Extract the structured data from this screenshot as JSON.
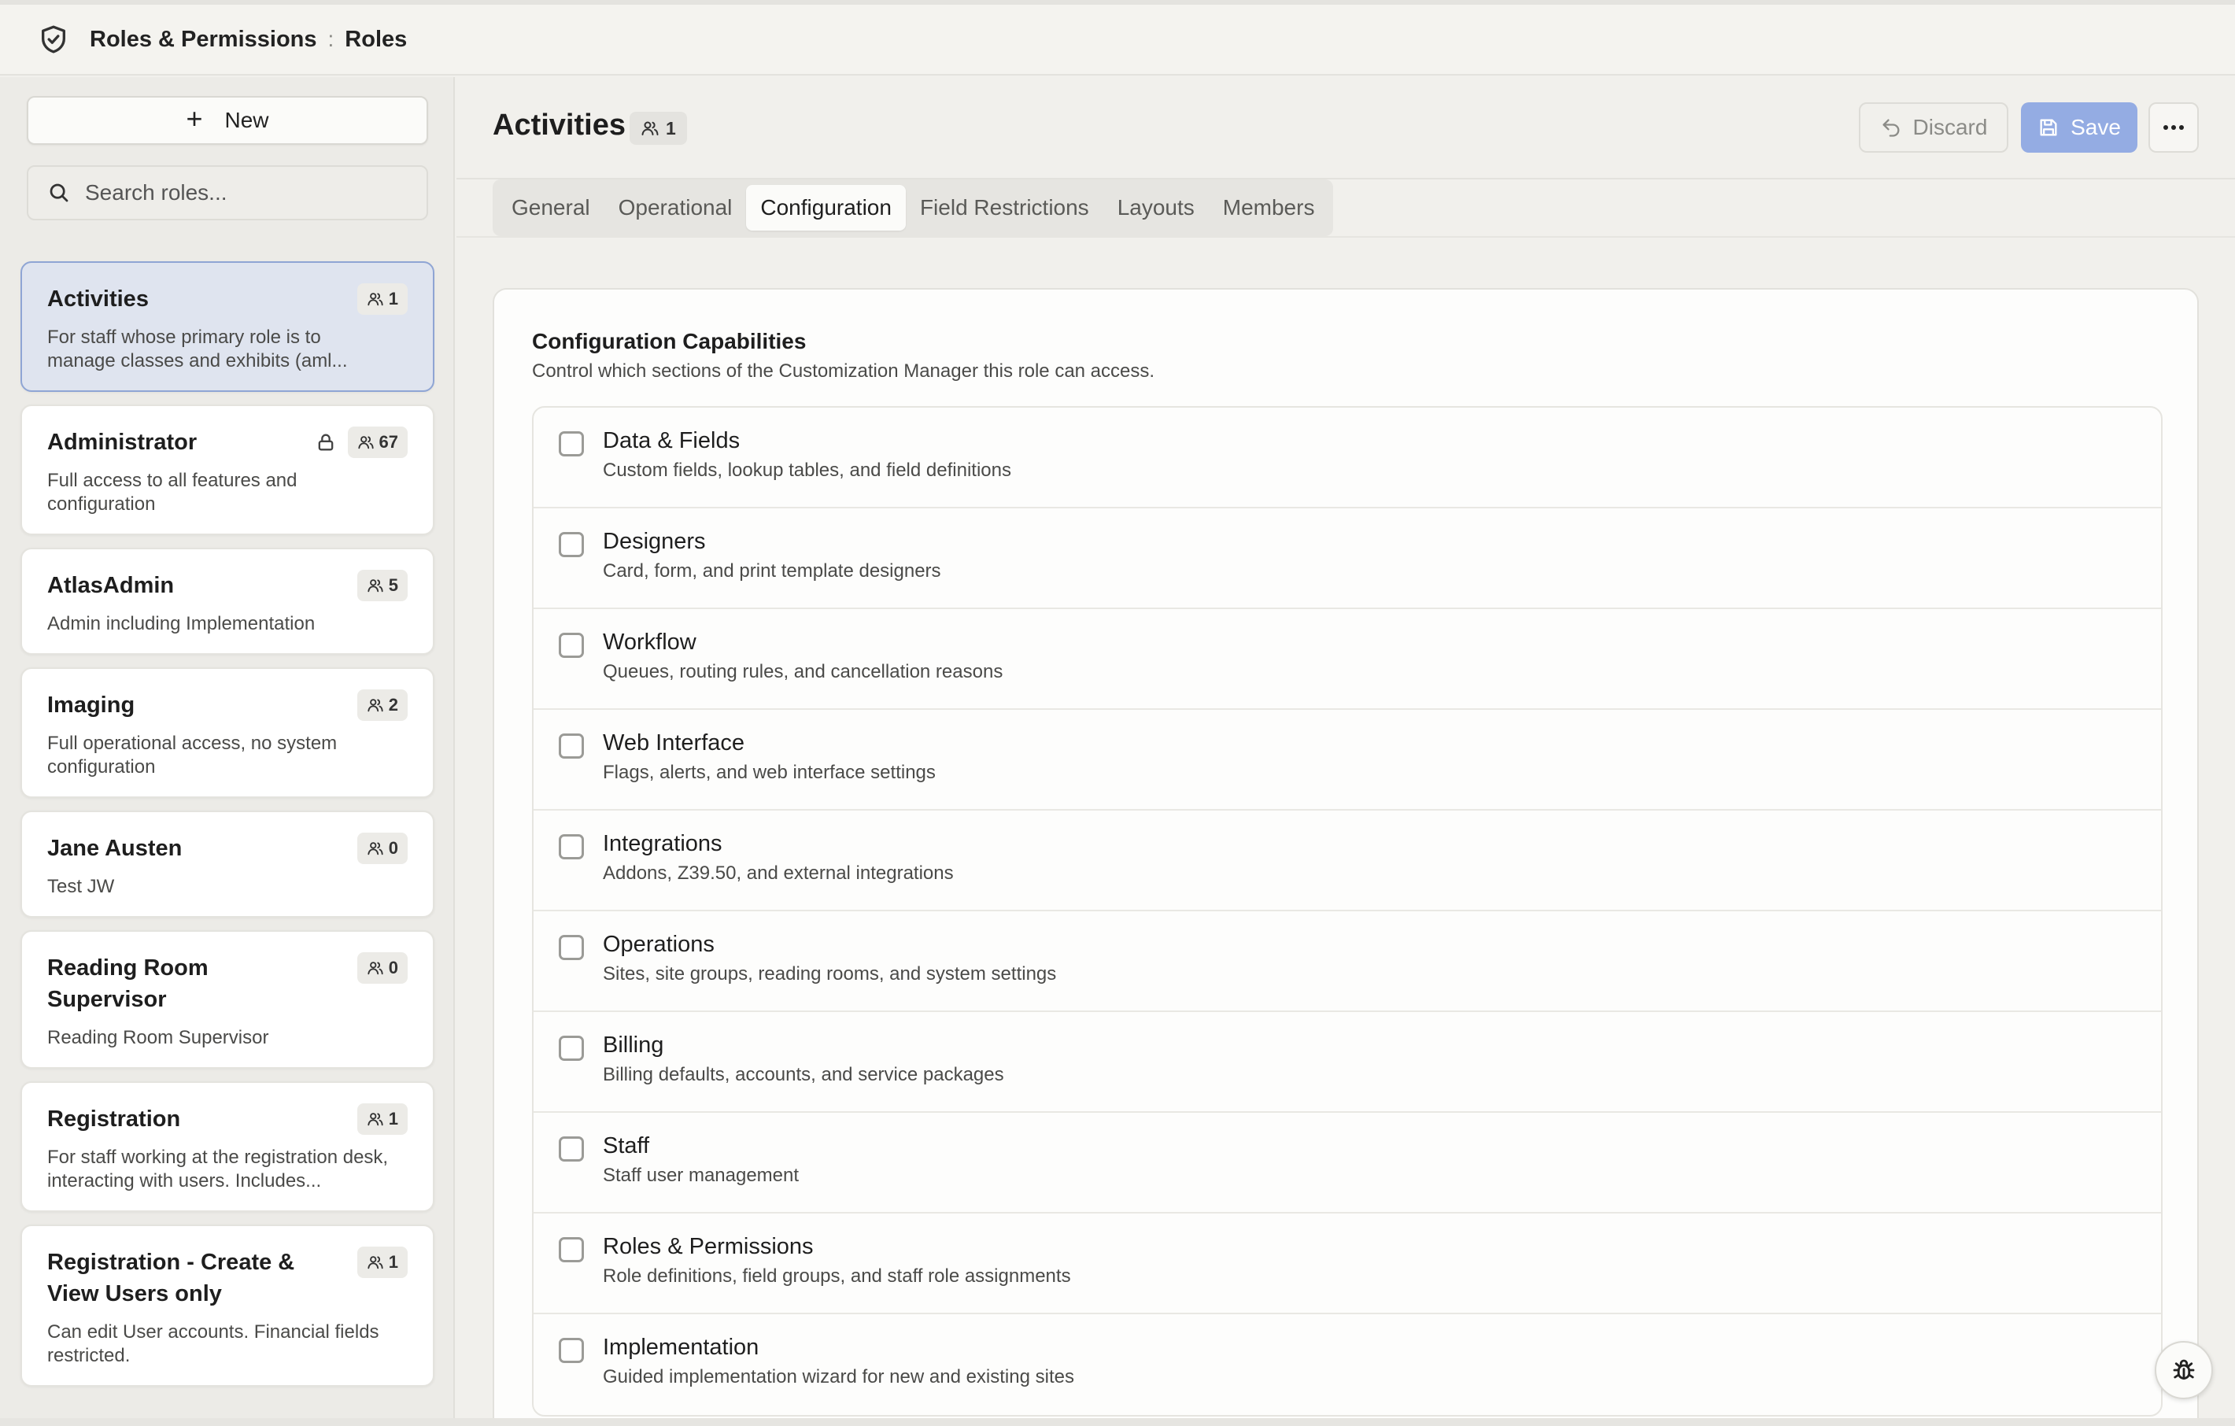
{
  "breadcrumb": {
    "section": "Roles & Permissions",
    "separator": ":",
    "page": "Roles"
  },
  "sidebar": {
    "new_label": "New",
    "search_placeholder": "Search roles...",
    "roles": [
      {
        "name": "Activities",
        "count": "1",
        "description": "For staff whose primary role is to manage classes and exhibits (aml...",
        "active": true,
        "locked": false
      },
      {
        "name": "Administrator",
        "count": "67",
        "description": "Full access to all features and configuration",
        "active": false,
        "locked": true
      },
      {
        "name": "AtlasAdmin",
        "count": "5",
        "description": "Admin including Implementation",
        "active": false,
        "locked": false
      },
      {
        "name": "Imaging",
        "count": "2",
        "description": "Full operational access, no system configuration",
        "active": false,
        "locked": false
      },
      {
        "name": "Jane Austen",
        "count": "0",
        "description": "Test JW",
        "active": false,
        "locked": false
      },
      {
        "name": "Reading Room Supervisor",
        "count": "0",
        "description": "Reading Room Supervisor",
        "active": false,
        "locked": false
      },
      {
        "name": "Registration",
        "count": "1",
        "description": "For staff working at the registration desk, interacting with users. Includes...",
        "active": false,
        "locked": false
      },
      {
        "name": "Registration - Create & View Users only",
        "count": "1",
        "description": "Can edit User accounts. Financial fields restricted.",
        "active": false,
        "locked": false
      }
    ]
  },
  "main": {
    "title": "Activities",
    "member_count": "1",
    "discard_label": "Discard",
    "save_label": "Save",
    "tabs": [
      {
        "label": "General",
        "active": false
      },
      {
        "label": "Operational",
        "active": false
      },
      {
        "label": "Configuration",
        "active": true
      },
      {
        "label": "Field Restrictions",
        "active": false
      },
      {
        "label": "Layouts",
        "active": false
      },
      {
        "label": "Members",
        "active": false
      }
    ],
    "panel": {
      "title": "Configuration Capabilities",
      "subtitle": "Control which sections of the Customization Manager this role can access.",
      "capabilities": [
        {
          "name": "Data & Fields",
          "description": "Custom fields, lookup tables, and field definitions",
          "checked": false
        },
        {
          "name": "Designers",
          "description": "Card, form, and print template designers",
          "checked": false
        },
        {
          "name": "Workflow",
          "description": "Queues, routing rules, and cancellation reasons",
          "checked": false
        },
        {
          "name": "Web Interface",
          "description": "Flags, alerts, and web interface settings",
          "checked": false
        },
        {
          "name": "Integrations",
          "description": "Addons, Z39.50, and external integrations",
          "checked": false
        },
        {
          "name": "Operations",
          "description": "Sites, site groups, reading rooms, and system settings",
          "checked": false
        },
        {
          "name": "Billing",
          "description": "Billing defaults, accounts, and service packages",
          "checked": false
        },
        {
          "name": "Staff",
          "description": "Staff user management",
          "checked": false
        },
        {
          "name": "Roles & Permissions",
          "description": "Role definitions, field groups, and staff role assignments",
          "checked": false
        },
        {
          "name": "Implementation",
          "description": "Guided implementation wizard for new and existing sites",
          "checked": false
        }
      ]
    }
  },
  "colors": {
    "accent": "#94ace3",
    "active_card": "#dfe4ef",
    "active_border": "#8fa5d4",
    "background": "#f1f0ec"
  },
  "icons": {
    "app": "shield-check-icon",
    "users": "users-icon",
    "lock": "lock-icon",
    "search": "search-icon",
    "plus": "plus-icon",
    "undo": "undo-icon",
    "save": "save-icon",
    "more": "more-horizontal-icon",
    "bug": "bug-icon"
  }
}
